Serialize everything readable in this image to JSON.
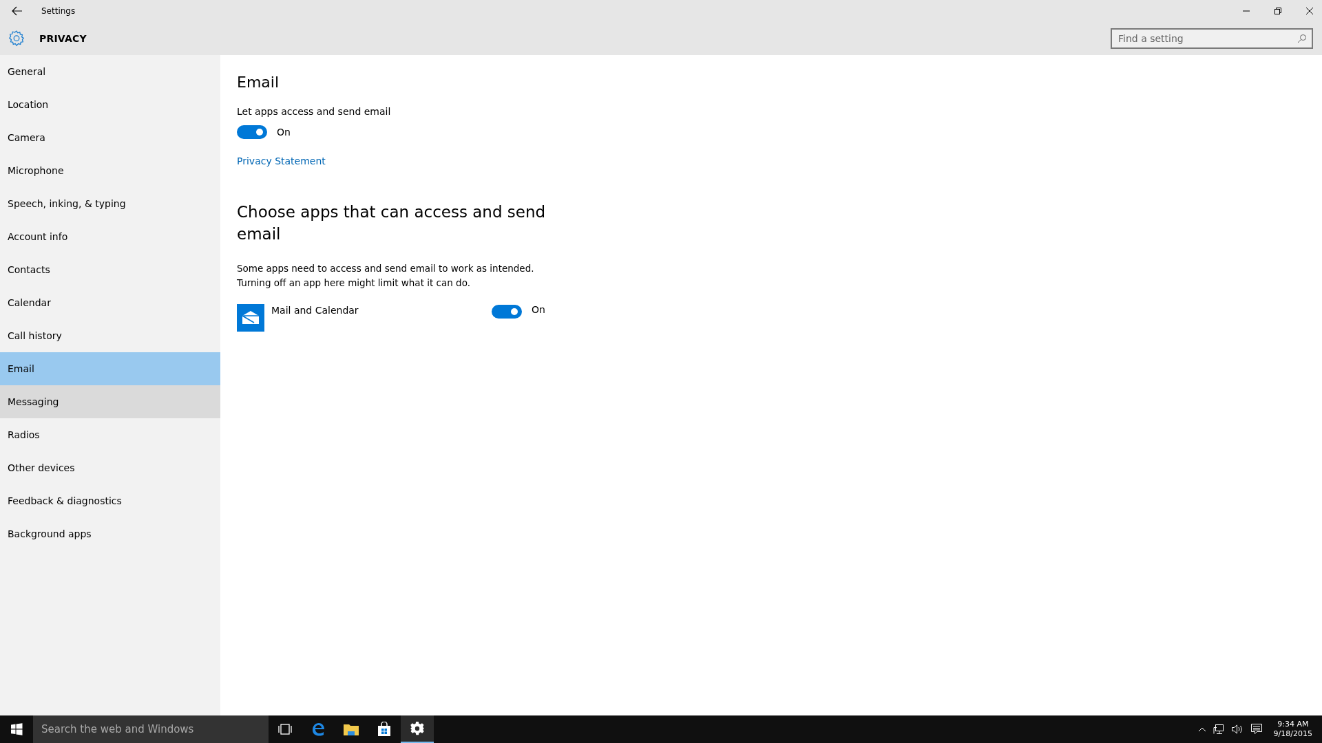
{
  "window": {
    "title": "Settings"
  },
  "header": {
    "title": "PRIVACY",
    "search": {
      "placeholder": "Find a setting"
    }
  },
  "sidebar": {
    "items": [
      {
        "label": "General",
        "selected": false,
        "hovered": false
      },
      {
        "label": "Location",
        "selected": false,
        "hovered": false
      },
      {
        "label": "Camera",
        "selected": false,
        "hovered": false
      },
      {
        "label": "Microphone",
        "selected": false,
        "hovered": false
      },
      {
        "label": "Speech, inking, & typing",
        "selected": false,
        "hovered": false
      },
      {
        "label": "Account info",
        "selected": false,
        "hovered": false
      },
      {
        "label": "Contacts",
        "selected": false,
        "hovered": false
      },
      {
        "label": "Calendar",
        "selected": false,
        "hovered": false
      },
      {
        "label": "Call history",
        "selected": false,
        "hovered": false
      },
      {
        "label": "Email",
        "selected": true,
        "hovered": false
      },
      {
        "label": "Messaging",
        "selected": false,
        "hovered": true
      },
      {
        "label": "Radios",
        "selected": false,
        "hovered": false
      },
      {
        "label": "Other devices",
        "selected": false,
        "hovered": false
      },
      {
        "label": "Feedback & diagnostics",
        "selected": false,
        "hovered": false
      },
      {
        "label": "Background apps",
        "selected": false,
        "hovered": false
      }
    ]
  },
  "content": {
    "title": "Email",
    "setting": {
      "label": "Let apps access and send email",
      "on": true,
      "state": "On"
    },
    "link": "Privacy Statement",
    "apps_heading": "Choose apps that can access and send email",
    "description": [
      "Some apps need to access and send email to work as intended.",
      "Turning off an app here might limit what it can do."
    ],
    "apps": [
      {
        "name": "Mail and Calendar",
        "on": true,
        "state": "On"
      }
    ]
  },
  "taskbar": {
    "search": {
      "placeholder": "Search the web and Windows"
    },
    "items": [
      {
        "kind": "taskview",
        "active": false
      },
      {
        "kind": "edge",
        "active": false
      },
      {
        "kind": "explorer",
        "active": false
      },
      {
        "kind": "store",
        "active": false
      },
      {
        "kind": "settings",
        "active": true
      }
    ],
    "time": "9:34 AM",
    "date": "9/18/2015"
  }
}
